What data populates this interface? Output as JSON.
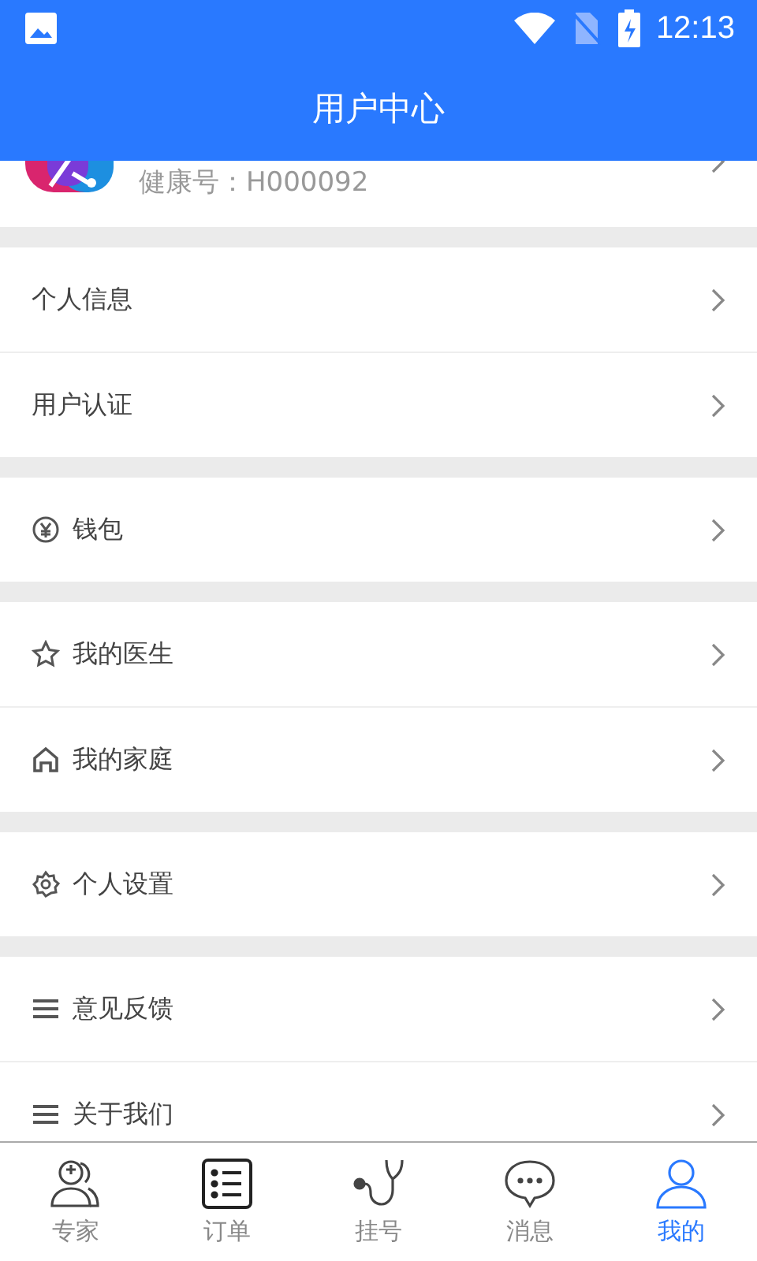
{
  "status_bar": {
    "time": "12:13"
  },
  "app_bar": {
    "title": "用户中心"
  },
  "profile": {
    "health_id": "健康号：H000092"
  },
  "sections": [
    {
      "items": [
        {
          "label": "个人信息",
          "kind": "plain"
        },
        {
          "label": "用户认证",
          "kind": "plain"
        }
      ]
    },
    {
      "items": [
        {
          "label": "钱包",
          "kind": "yen"
        }
      ]
    },
    {
      "items": [
        {
          "label": "我的医生",
          "kind": "star"
        },
        {
          "label": "我的家庭",
          "kind": "home"
        }
      ]
    },
    {
      "items": [
        {
          "label": "个人设置",
          "kind": "gear"
        }
      ]
    },
    {
      "items": [
        {
          "label": "意见反馈",
          "kind": "menu"
        },
        {
          "label": "关于我们",
          "kind": "menu"
        }
      ]
    }
  ],
  "tabs": [
    {
      "label": "专家",
      "kind": "doctor",
      "selected": false
    },
    {
      "label": "订单",
      "kind": "list",
      "selected": false
    },
    {
      "label": "挂号",
      "kind": "stethoscope",
      "selected": false
    },
    {
      "label": "消息",
      "kind": "chat",
      "selected": false
    },
    {
      "label": "我的",
      "kind": "person",
      "selected": true
    }
  ]
}
